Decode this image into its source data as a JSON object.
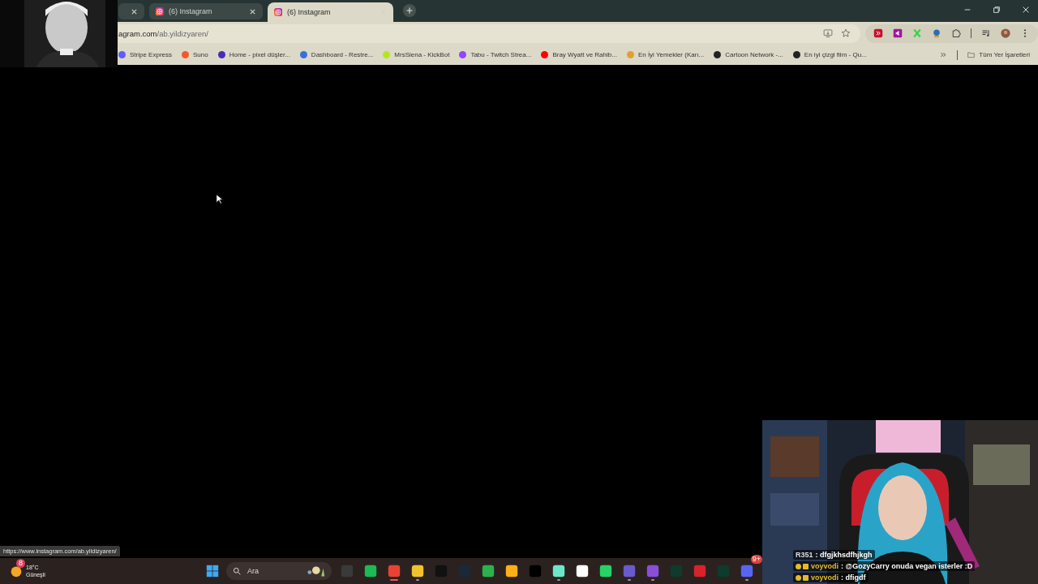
{
  "tabs": [
    {
      "selected": false
    },
    {
      "title": "(6) Instagram",
      "selected": false
    },
    {
      "title": "(6) Instagram",
      "selected": true
    }
  ],
  "address_bar": {
    "url_host": "agram.com",
    "url_path": "/ab.yildizyaren/"
  },
  "bookmarks": [
    {
      "title": "Stripe Express",
      "color": "#635bff"
    },
    {
      "title": "Suno",
      "color": "#f05a28"
    },
    {
      "title": "Home - pixel düşler...",
      "color": "#4b2bb8"
    },
    {
      "title": "Dashboard - Restre...",
      "color": "#3b6fd8"
    },
    {
      "title": "MrsSiena - KickBot",
      "color": "#b5e61d"
    },
    {
      "title": "Tabu - Twitch Strea...",
      "color": "#9146ff"
    },
    {
      "title": "Bray Wyatt ve Rahib...",
      "color": "#ff0000"
    },
    {
      "title": "En İyi Yemekler (Karı...",
      "color": "#e0a030"
    },
    {
      "title": "Cartoon Network -...",
      "color": "#222222"
    },
    {
      "title": "En iyi çizgi film - Qu...",
      "color": "#222222"
    }
  ],
  "all_bookmarks": "Tüm Yer İşaretleri",
  "status_url": "https://www.instagram.com/ab.yildizyaren/",
  "taskbar": {
    "weather": {
      "temp": "18°C",
      "condition": "Güneşli",
      "badge": "8"
    },
    "search": {
      "placeholder": "Ara"
    },
    "apps": [
      {
        "color": "#3a3a3a",
        "running": false
      },
      {
        "color": "#1db954",
        "running": false
      },
      {
        "color": "#e94235",
        "running": true,
        "selected": true
      },
      {
        "color": "#f2c12e",
        "running": true,
        "selected": false
      },
      {
        "color": "#111111",
        "running": false
      },
      {
        "color": "#1b2838",
        "running": false
      },
      {
        "color": "#2bb24c",
        "running": false
      },
      {
        "color": "#fcaf17",
        "running": false
      },
      {
        "color": "#000000",
        "running": false
      },
      {
        "color": "#6ee7c8",
        "running": true,
        "selected": false
      },
      {
        "color": "#ffffff",
        "running": false
      },
      {
        "color": "#25d366",
        "running": false
      },
      {
        "color": "#6a5acd",
        "running": true,
        "selected": false
      },
      {
        "color": "#8a4fd8",
        "running": true,
        "selected": false
      },
      {
        "color": "#0e3b2e",
        "running": false
      },
      {
        "color": "#d8232a",
        "running": false
      },
      {
        "color": "#0e3b2e",
        "running": false
      },
      {
        "color": "#5865f2",
        "running": true,
        "selected": false,
        "badge": "9+"
      }
    ]
  },
  "chat": [
    {
      "user": "R351",
      "badges": false,
      "message": ": dfgjkhsdfhjkgh"
    },
    {
      "user": "voyvodi",
      "color": "#e8b923",
      "badges": true,
      "message": ": @GozyCarry onuda vegan isterler :D"
    },
    {
      "user": "voyvodi",
      "color": "#e8b923",
      "badges": true,
      "message": ": dfigdf"
    }
  ]
}
